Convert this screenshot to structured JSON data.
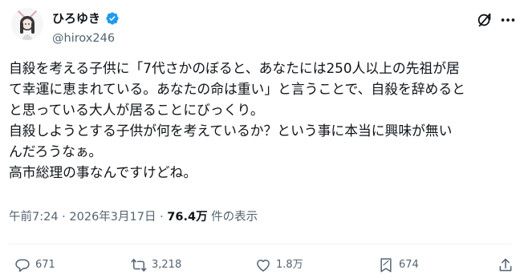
{
  "author": {
    "name": "ひろゆき",
    "handle": "@hirox246"
  },
  "post": {
    "lines": [
      "自殺を考える子供に「7代さかのぼると、あなたには250人以上の先祖が居",
      "て幸運に恵まれている。あなたの命は重い」と言うことで、自殺を辞めると",
      "と思っている大人が居ることにびっくり。",
      "自殺しようとする子供が何を考えているか？という事に本当に興味が無い",
      "んだろうなぁ。",
      "高市総理の事なんですけどね。"
    ]
  },
  "meta": {
    "time": "午前7:24",
    "separator1": " · ",
    "date": "2026年3月17日",
    "separator2": " · ",
    "views": "76.4万",
    "views_suffix": " 件の表示"
  },
  "actions": {
    "reply_count": "671",
    "repost_count": "3,218",
    "like_count": "1.8万",
    "bookmark_count": "674"
  },
  "icons": {
    "verified": "verified-badge-icon",
    "grok": "grok-icon",
    "more": "more-icon",
    "reply": "reply-icon",
    "repost": "repost-icon",
    "like": "heart-icon",
    "bookmark": "bookmark-icon",
    "share": "share-icon"
  },
  "colors": {
    "verified": "#1d9bf0",
    "secondary_text": "#536471",
    "primary_text": "#0f1419"
  }
}
